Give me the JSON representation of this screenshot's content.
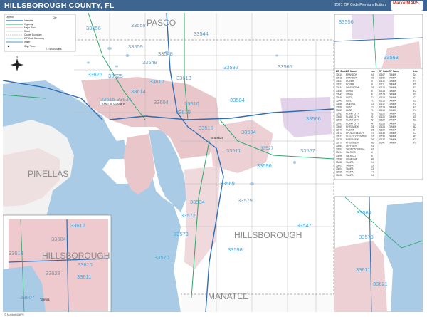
{
  "header": {
    "title": "HILLSBOROUGH COUNTY, FL",
    "edition": "2021 ZIP Code Premium Edition",
    "logo_text": "MarketMAPS",
    "bar_color": "#3d6590"
  },
  "map": {
    "region_labels": [
      "PASCO",
      "HILLSBOROUGH",
      "MANATEE",
      "HILLSBOROUGH",
      "PINELLAS"
    ],
    "city_labels": [
      "Town 'n' Country",
      "Brandon",
      "Tampa"
    ],
    "colors": {
      "water": "#a9cbe6",
      "land": "#ffffff",
      "urban": "#e9c6c9",
      "county_fill": "#ece4f0",
      "interstate": "#2f6db3",
      "highway": "#2ea86c",
      "boundary": "#999999"
    },
    "zip_labels": [
      "33556",
      "33558",
      "33544",
      "33559",
      "33548",
      "33549",
      "33592",
      "33565",
      "33626",
      "33625",
      "33612",
      "33613",
      "33615",
      "33634",
      "33614",
      "33604",
      "33610",
      "33584",
      "33566",
      "33619",
      "33594",
      "33510",
      "33511",
      "33567",
      "33527",
      "33596",
      "33569",
      "33534",
      "33570",
      "33579",
      "33572",
      "33573",
      "33547",
      "33598"
    ],
    "inset_top_right": {
      "zip_labels": [
        "33556",
        "33563"
      ]
    },
    "inset_bottom_left": {
      "zip_labels": [
        "33612",
        "33604",
        "33614",
        "33610",
        "33623",
        "33611",
        "33607"
      ],
      "place": "HILLSBOROUGH",
      "city": "Tampa"
    },
    "inset_bottom_right": {
      "zip_labels": [
        "33569",
        "33579",
        "33611",
        "33621"
      ]
    }
  },
  "legend": {
    "title": "Legend",
    "items": [
      "Interstate",
      "Highway",
      "Major Road",
      "Road",
      "County Boundary",
      "ZIP Code Boundary",
      "Water",
      "City / Town"
    ],
    "scale_text": "0 2.5 5 10 Miles",
    "city_sample": "City"
  },
  "zip_table": {
    "headers": [
      "ZIP Code",
      "ZIP Name",
      "Loc"
    ],
    "rows_left": [
      [
        "33510",
        "BRANDON",
        "H4"
      ],
      [
        "33511",
        "BRANDON",
        "H5"
      ],
      [
        "33523",
        "DOVER",
        "I4"
      ],
      [
        "33527",
        "DOVER",
        "I4"
      ],
      [
        "33534",
        "GIBSONTON",
        "G6"
      ],
      [
        "33540",
        "LITHIA",
        "I5"
      ],
      [
        "33547",
        "LITHIA",
        "I6"
      ],
      [
        "33548",
        "LUTZ",
        "E1"
      ],
      [
        "33549",
        "LUTZ",
        "F1"
      ],
      [
        "33556",
        "ODESSA",
        "D1"
      ],
      [
        "33558",
        "LUTZ",
        "E1"
      ],
      [
        "33559",
        "LUTZ",
        "F1"
      ],
      [
        "33563",
        "PLANT CITY",
        "J3"
      ],
      [
        "33565",
        "PLANT CITY",
        "J2"
      ],
      [
        "33566",
        "PLANT CITY",
        "J3"
      ],
      [
        "33567",
        "PLANT CITY",
        "J4"
      ],
      [
        "33569",
        "RIVERVIEW",
        "G5"
      ],
      [
        "33570",
        "RUSKIN",
        "G8"
      ],
      [
        "33572",
        "APOLLO BEACH",
        "G7"
      ],
      [
        "33573",
        "SUN CITY CENTER",
        "G7"
      ],
      [
        "33578",
        "RIVERVIEW",
        "G6"
      ],
      [
        "33579",
        "RIVERVIEW",
        "H6"
      ],
      [
        "33584",
        "SEFFNER",
        "H3"
      ],
      [
        "33592",
        "THONOTOSASSA",
        "H2"
      ],
      [
        "33594",
        "VALRICO",
        "I4"
      ],
      [
        "33596",
        "VALRICO",
        "I5"
      ],
      [
        "33598",
        "WIMAUMA",
        "H8"
      ],
      [
        "33602",
        "TAMPA",
        "E4"
      ],
      [
        "33603",
        "TAMPA",
        "E3"
      ],
      [
        "33604",
        "TAMPA",
        "E3"
      ],
      [
        "33605",
        "TAMPA",
        "F4"
      ],
      [
        "33606",
        "TAMPA",
        "E4"
      ]
    ],
    "rows_right": [
      [
        "33607",
        "TAMPA",
        "D4"
      ],
      [
        "33609",
        "TAMPA",
        "D4"
      ],
      [
        "33610",
        "TAMPA",
        "F3"
      ],
      [
        "33611",
        "TAMPA",
        "D5"
      ],
      [
        "33612",
        "TAMPA",
        "E2"
      ],
      [
        "33613",
        "TAMPA",
        "E2"
      ],
      [
        "33614",
        "TAMPA",
        "D3"
      ],
      [
        "33615",
        "TAMPA",
        "C3"
      ],
      [
        "33616",
        "TAMPA",
        "D5"
      ],
      [
        "33617",
        "TAMPA",
        "F2"
      ],
      [
        "33618",
        "TAMPA",
        "E2"
      ],
      [
        "33619",
        "TAMPA",
        "F4"
      ],
      [
        "33620",
        "TAMPA",
        "F2"
      ],
      [
        "33621",
        "TAMPA",
        "D5"
      ],
      [
        "33624",
        "TAMPA",
        "D2"
      ],
      [
        "33625",
        "TAMPA",
        "C2"
      ],
      [
        "33626",
        "TAMPA",
        "B2"
      ],
      [
        "33629",
        "TAMPA",
        "D4"
      ],
      [
        "33634",
        "TAMPA",
        "C3"
      ],
      [
        "33635",
        "TAMPA",
        "B3"
      ],
      [
        "33637",
        "TAMPA",
        "F2"
      ],
      [
        "33647",
        "TAMPA",
        "F1"
      ]
    ]
  },
  "footer": {
    "copyright": "© MarketMAPS"
  }
}
